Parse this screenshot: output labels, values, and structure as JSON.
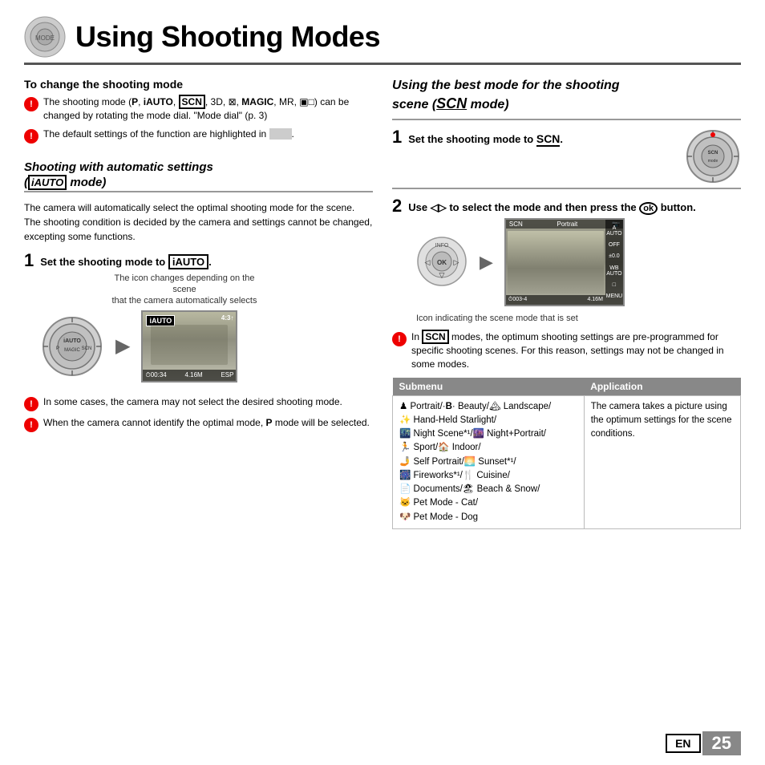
{
  "header": {
    "title": "Using Shooting Modes"
  },
  "left_col": {
    "section1_title": "To change the shooting mode",
    "bullet1": "The shooting mode (P, iAUTO, SCN, 3D, ⊠, MAGIC, MR, ▣□) can be changed by rotating the mode dial. \"Mode dial\" (p. 3)",
    "bullet2": "The default settings of the function are highlighted in",
    "section2_title_italic": "Shooting with automatic settings",
    "section2_title_italic2": "(iAUTO mode)",
    "body_text": "The camera will automatically select the optimal shooting mode for the scene. The shooting condition is decided by the camera and settings cannot be changed, excepting some functions.",
    "step1_label": "1",
    "step1_text": "Set the shooting mode to iAUTO.",
    "caption": "The icon changes depending on the scene\nthat the camera automatically selects",
    "bullet3": "In some cases, the camera may not select the desired shooting mode.",
    "bullet4": "When the camera cannot identify the optimal mode, P mode will be selected."
  },
  "right_col": {
    "section_title_line1": "Using the best mode for the shooting",
    "section_title_line2": "scene (SCN mode)",
    "step1_label": "1",
    "step1_text": "Set the shooting mode to SCN.",
    "step2_label": "2",
    "step2_text": "Use ◁▷ to select the mode and then press the ⊛ button.",
    "caption": "Icon indicating the scene mode\nthat is set",
    "bullet": "In SCN modes, the optimum shooting settings are pre-programmed for specific shooting scenes. For this reason, settings may not be changed in some modes.",
    "table": {
      "col1_header": "Submenu",
      "col2_header": "Application",
      "col1_content": "♟ Portrait/·B· Beauty/🏔 Landscape/\n🌟 Hand-Held Starlight/\n🌃 Night Scene*¹/🌆 Night+Portrait/\n🏃 Sport/🏠 Indoor/\n🤳 Self Portrait/🌅 Sunset*¹/\n🎆 Fireworks*¹/🍴 Cuisine/\n📄 Documents/🏖 Beach & Snow/\n🐱 Pet Mode - Cat/\n🐶 Pet Mode - Dog",
      "col2_content": "The camera takes a picture using the optimum settings for the scene conditions."
    }
  },
  "footer": {
    "lang": "EN",
    "page": "25"
  },
  "icons": {
    "bullet_icon": "!",
    "arrow": "▶"
  }
}
